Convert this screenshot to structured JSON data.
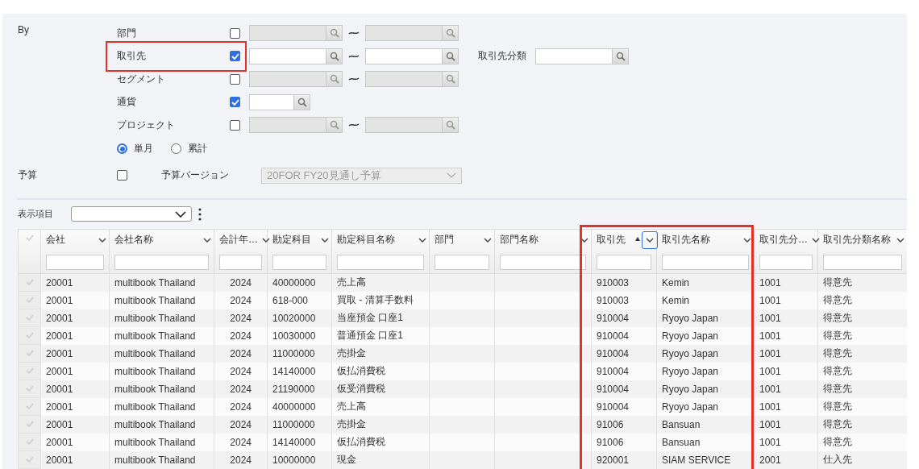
{
  "filters": {
    "label": "By",
    "rows": [
      {
        "label": "部門",
        "checked": false,
        "kind": "range",
        "highlighted": false
      },
      {
        "label": "取引先",
        "checked": true,
        "kind": "range",
        "highlighted": true,
        "extra": {
          "label": "取引先分類"
        }
      },
      {
        "label": "セグメント",
        "checked": false,
        "kind": "range",
        "highlighted": false
      },
      {
        "label": "通貨",
        "checked": true,
        "kind": "single",
        "highlighted": false
      },
      {
        "label": "プロジェクト",
        "checked": false,
        "kind": "range",
        "highlighted": false
      }
    ],
    "period_options": [
      {
        "label": "単月",
        "selected": true
      },
      {
        "label": "累計",
        "selected": false
      }
    ]
  },
  "budget": {
    "label": "予算",
    "checked": false,
    "version_label": "予算バージョン",
    "version_value": "20FOR FY20見通し予算",
    "disabled": true
  },
  "display": {
    "label": "表示項目"
  },
  "table": {
    "columns": [
      {
        "label": "会社",
        "kind": "text",
        "sorted": false,
        "focused": false,
        "highlighted": false
      },
      {
        "label": "会社名称",
        "kind": "text",
        "sorted": false,
        "focused": false,
        "highlighted": false
      },
      {
        "label": "会計年…",
        "kind": "number",
        "sorted": false,
        "focused": false,
        "highlighted": false
      },
      {
        "label": "勘定科目",
        "kind": "text",
        "sorted": false,
        "focused": false,
        "highlighted": false
      },
      {
        "label": "勘定科目名称",
        "kind": "text",
        "sorted": false,
        "focused": false,
        "highlighted": false
      },
      {
        "label": "部門",
        "kind": "text",
        "sorted": false,
        "focused": false,
        "highlighted": false
      },
      {
        "label": "部門名称",
        "kind": "text",
        "sorted": false,
        "focused": false,
        "highlighted": false
      },
      {
        "label": "取引先",
        "kind": "text",
        "sorted": true,
        "focused": true,
        "highlighted": true
      },
      {
        "label": "取引先名称",
        "kind": "text",
        "sorted": false,
        "focused": false,
        "highlighted": true
      },
      {
        "label": "取引先分…",
        "kind": "text",
        "sorted": false,
        "focused": false,
        "highlighted": false
      },
      {
        "label": "取引先分類名称",
        "kind": "text",
        "sorted": false,
        "focused": false,
        "highlighted": false
      }
    ],
    "rows": [
      {
        "selected": false,
        "cells": [
          "20001",
          "multibook Thailand",
          "2024",
          "40000000",
          "売上高",
          "",
          "",
          "910003",
          "Kemin",
          "1001",
          "得意先"
        ]
      },
      {
        "selected": false,
        "cells": [
          "20001",
          "multibook Thailand",
          "2024",
          "618-000",
          "買取 - 清算手数料",
          "",
          "",
          "910003",
          "Kemin",
          "1001",
          "得意先"
        ]
      },
      {
        "selected": false,
        "cells": [
          "20001",
          "multibook Thailand",
          "2024",
          "10020000",
          "当座預金 口座1",
          "",
          "",
          "910004",
          "Ryoyo Japan",
          "1001",
          "得意先"
        ]
      },
      {
        "selected": false,
        "cells": [
          "20001",
          "multibook Thailand",
          "2024",
          "10030000",
          "普通預金 口座1",
          "",
          "",
          "910004",
          "Ryoyo Japan",
          "1001",
          "得意先"
        ]
      },
      {
        "selected": false,
        "cells": [
          "20001",
          "multibook Thailand",
          "2024",
          "11000000",
          "売掛金",
          "",
          "",
          "910004",
          "Ryoyo Japan",
          "1001",
          "得意先"
        ]
      },
      {
        "selected": false,
        "cells": [
          "20001",
          "multibook Thailand",
          "2024",
          "14140000",
          "仮払消費税",
          "",
          "",
          "910004",
          "Ryoyo Japan",
          "1001",
          "得意先"
        ]
      },
      {
        "selected": false,
        "cells": [
          "20001",
          "multibook Thailand",
          "2024",
          "21190000",
          "仮受消費税",
          "",
          "",
          "910004",
          "Ryoyo Japan",
          "1001",
          "得意先"
        ]
      },
      {
        "selected": false,
        "cells": [
          "20001",
          "multibook Thailand",
          "2024",
          "40000000",
          "売上高",
          "",
          "",
          "910004",
          "Ryoyo Japan",
          "1001",
          "得意先"
        ]
      },
      {
        "selected": false,
        "cells": [
          "20001",
          "multibook Thailand",
          "2024",
          "11000000",
          "売掛金",
          "",
          "",
          "91006",
          "Bansuan",
          "1001",
          "得意先"
        ]
      },
      {
        "selected": false,
        "cells": [
          "20001",
          "multibook Thailand",
          "2024",
          "14140000",
          "仮払消費税",
          "",
          "",
          "91006",
          "Bansuan",
          "1001",
          "得意先"
        ]
      },
      {
        "selected": false,
        "cells": [
          "20001",
          "multibook Thailand",
          "2024",
          "10000000",
          "現金",
          "",
          "",
          "920001",
          "SIAM SERVICE",
          "2001",
          "仕入先"
        ]
      }
    ]
  }
}
